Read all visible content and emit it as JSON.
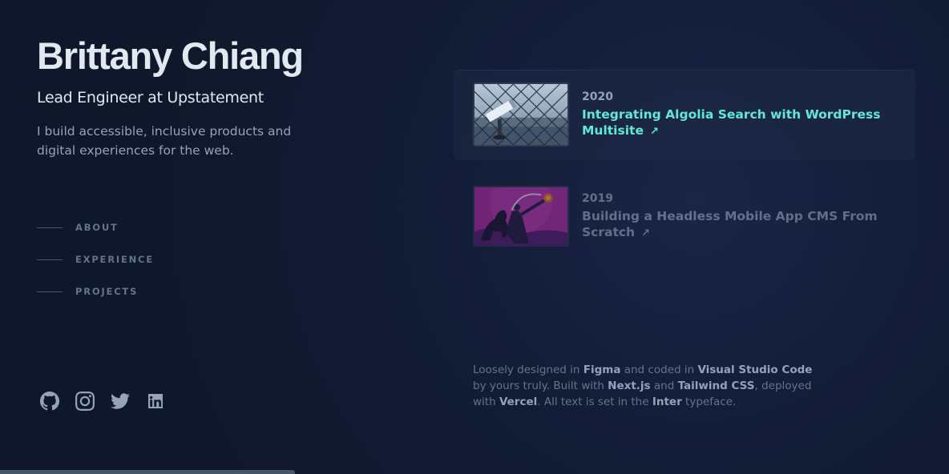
{
  "header": {
    "name": "Brittany Chiang",
    "role": "Lead Engineer at Upstatement",
    "tagline": "I build accessible, inclusive products and digital experiences for the web."
  },
  "nav": {
    "items": [
      {
        "label": "ABOUT"
      },
      {
        "label": "EXPERIENCE"
      },
      {
        "label": "PROJECTS"
      }
    ]
  },
  "socials": {
    "icons": [
      "github-icon",
      "instagram-icon",
      "twitter-icon",
      "linkedin-icon"
    ]
  },
  "writing": {
    "items": [
      {
        "year": "2020",
        "title": "Integrating Algolia Search with WordPress Multisite",
        "arrow": "↗"
      },
      {
        "year": "2019",
        "title": "Building a Headless Mobile App CMS From Scratch",
        "arrow": "↗"
      }
    ]
  },
  "footer": {
    "t1": "Loosely designed in ",
    "figma": "Figma",
    "t2": " and coded in ",
    "vscode": "Visual Studio Code",
    "t3": " by yours truly. Built with ",
    "nextjs": "Next.js",
    "t4": " and ",
    "tailwind": "Tailwind CSS",
    "t5": ", deployed with ",
    "vercel": "Vercel",
    "t6": ". All text is set in the ",
    "inter": "Inter",
    "t7": " typeface."
  },
  "colors": {
    "background": "#0f172a",
    "accent": "#5eead4",
    "heading": "#e2e8f0",
    "body": "#94a3b8",
    "muted": "#64748b"
  }
}
